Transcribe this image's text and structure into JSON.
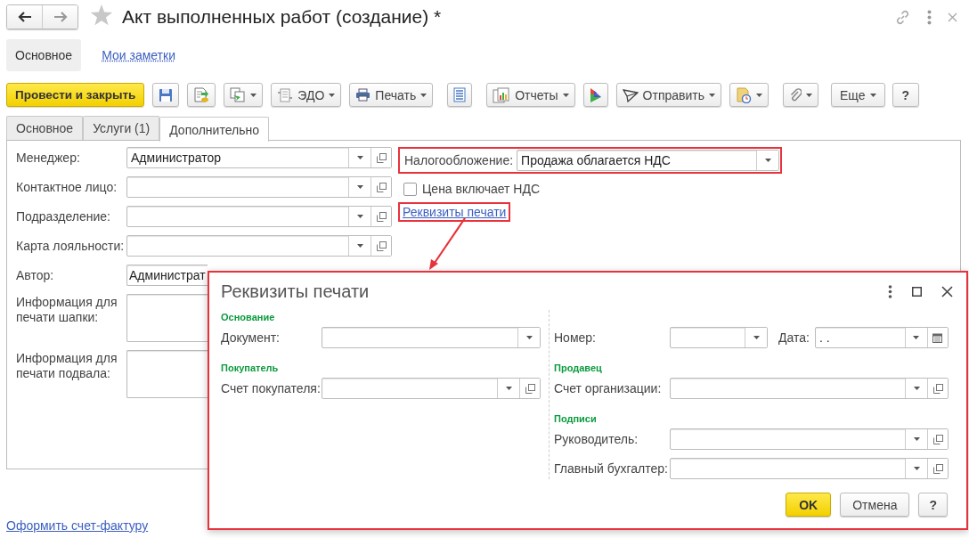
{
  "window": {
    "title": "Акт выполненных работ (создание) *"
  },
  "nav_tabs": [
    {
      "label": "Основное",
      "selected": true
    },
    {
      "label": "Мои заметки",
      "selected": false
    }
  ],
  "toolbar": [
    {
      "kind": "primary",
      "label": "Провести и закрыть",
      "dropdown": false
    },
    {
      "kind": "icon",
      "dropdown": false
    },
    {
      "kind": "icon",
      "dropdown": false
    },
    {
      "kind": "icon",
      "dropdown": true
    },
    {
      "kind": "button",
      "label": "ЭДО",
      "dropdown": true
    },
    {
      "kind": "button",
      "label": "Печать",
      "dropdown": true
    },
    {
      "kind": "icon",
      "dropdown": false
    },
    {
      "kind": "button",
      "label": "Отчеты",
      "dropdown": true
    },
    {
      "kind": "icon",
      "dropdown": false
    },
    {
      "kind": "button",
      "label": "Отправить",
      "dropdown": true
    },
    {
      "kind": "icon",
      "dropdown": true
    },
    {
      "kind": "icon",
      "dropdown": true
    },
    {
      "kind": "text",
      "label": "Еще",
      "dropdown": true
    },
    {
      "kind": "text",
      "label": "?",
      "dropdown": false
    }
  ],
  "tabs": [
    {
      "label": "Основное",
      "selected": false
    },
    {
      "label": "Услуги (1)",
      "selected": false
    },
    {
      "label": "Дополнительно",
      "selected": true
    }
  ],
  "left_fields": [
    {
      "kind": "select",
      "label": "Менеджер:",
      "value": "Администратор"
    },
    {
      "kind": "select",
      "label": "Контактное лицо:"
    },
    {
      "kind": "select",
      "label": "Подразделение:"
    },
    {
      "kind": "select",
      "label": "Карта лояльности:"
    },
    {
      "kind": "text",
      "label": "Автор:",
      "value": "Администрат"
    },
    {
      "kind": "memo",
      "label": "Информация для печати шапки:"
    },
    {
      "kind": "memo",
      "label": "Информация для печати подвала:"
    }
  ],
  "taxation": {
    "label": "Налогообложение:",
    "value": "Продажа облагается НДС"
  },
  "price_includes_vat": {
    "label": "Цена включает НДС",
    "checked": false
  },
  "print_details_link": "Реквизиты печати",
  "dialog": {
    "title": "Реквизиты печати",
    "left": [
      {
        "kind": "heading",
        "text": "Основание"
      },
      {
        "kind": "field",
        "label": "Документ:",
        "open_button": false
      },
      {
        "kind": "heading",
        "text": "Покупатель"
      },
      {
        "kind": "field",
        "label": "Счет покупателя:",
        "open_button": true
      }
    ],
    "right": [
      {
        "kind": "number_date",
        "label": "Номер:",
        "date_label": "Дата:",
        "date_value": ".  ."
      },
      {
        "kind": "heading",
        "text": "Продавец"
      },
      {
        "kind": "field",
        "label": "Счет организации:",
        "open_button": true
      },
      {
        "kind": "heading",
        "text": "Подписи"
      },
      {
        "kind": "field",
        "label": "Руководитель:",
        "open_button": true
      },
      {
        "kind": "field",
        "label": "Главный бухгалтер:",
        "open_button": true
      }
    ],
    "buttons": [
      {
        "kind": "primary",
        "label": "OK"
      },
      {
        "kind": "default",
        "label": "Отмена"
      },
      {
        "kind": "default",
        "label": "?"
      }
    ]
  },
  "footer_link": "Оформить счет-фактуру"
}
